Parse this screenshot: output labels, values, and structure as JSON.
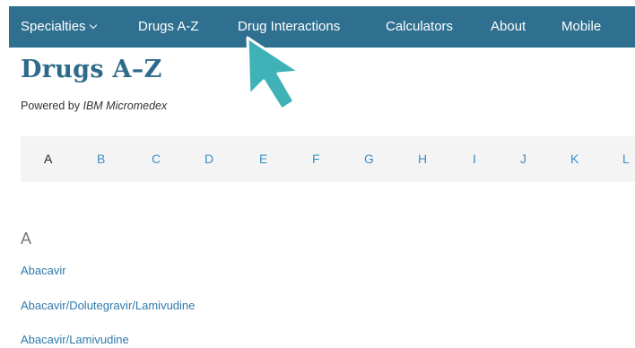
{
  "nav": {
    "items": [
      {
        "label": "Specialties",
        "has_dropdown": true
      },
      {
        "label": "Drugs A-Z"
      },
      {
        "label": "Drug Interactions"
      },
      {
        "label": "Calculators"
      },
      {
        "label": "About"
      },
      {
        "label": "Mobile"
      }
    ]
  },
  "page": {
    "title": "Drugs A–Z",
    "powered_prefix": "Powered by ",
    "powered_brand": "IBM Micromedex"
  },
  "alphabet": {
    "active": "A",
    "letters": [
      "A",
      "B",
      "C",
      "D",
      "E",
      "F",
      "G",
      "H",
      "I",
      "J",
      "K",
      "L"
    ]
  },
  "listing": {
    "section": "A",
    "drugs": [
      "Abacavir",
      "Abacavir/Dolutegravir/Lamivudine",
      "Abacavir/Lamivudine"
    ]
  },
  "colors": {
    "nav_bg": "#2f7090",
    "title": "#2e6a8a",
    "link": "#2f7aac",
    "cursor": "#3fb2b8"
  },
  "icons": {
    "cursor": "pointer-arrow-icon",
    "dropdown": "chevron-down-icon"
  }
}
